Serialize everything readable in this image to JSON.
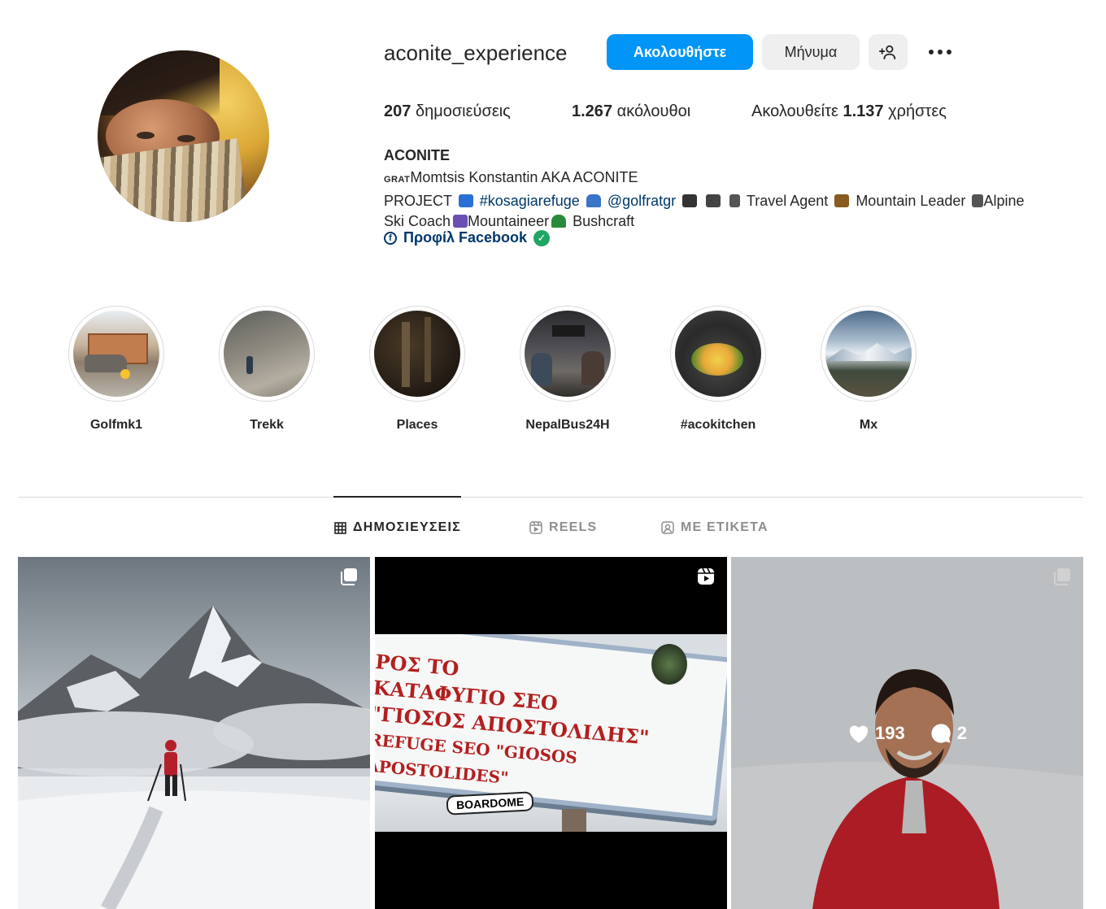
{
  "profile": {
    "username": "aconite_experience",
    "follow_label": "Ακολουθήστε",
    "message_label": "Μήνυμα",
    "add_user_icon": "add-user-icon",
    "more_icon": "more-icon",
    "stats": {
      "posts_count": "207",
      "posts_label": "δημοσιεύσεις",
      "followers_count": "1.267",
      "followers_label": "ακόλουθοι",
      "following_prefix": "Ακολουθείτε",
      "following_count": "1.137",
      "following_suffix": "χρήστες"
    },
    "bio": {
      "name": "ACONITE",
      "line1_small": "GRAT",
      "line1": "Momtsis Konstantin AKA ACONITE",
      "project": "PROJECT",
      "hashtag": "#kosagiarefuge",
      "mention": "@golfratgr",
      "travel": "Travel Agent",
      "mountain": "Mountain Leader",
      "alpine": "Alpine",
      "ski": "Ski Coach",
      "mountaineer": "Mountaineer",
      "bushcraft": "Bushcraft"
    },
    "facebook_label": "Προφίλ Facebook"
  },
  "highlights": [
    {
      "label": "Golfmk1"
    },
    {
      "label": "Trekk"
    },
    {
      "label": "Places"
    },
    {
      "label": "NepalBus24H"
    },
    {
      "label": "#acokitchen"
    },
    {
      "label": "Mx"
    }
  ],
  "tabs": [
    {
      "label": "ΔΗΜΟΣΙΕΥΣΕΙΣ",
      "icon": "grid-icon",
      "active": true
    },
    {
      "label": "REELS",
      "icon": "reels-icon",
      "active": false
    },
    {
      "label": "ΜΕ ΕΤΙΚΕΤΑ",
      "icon": "tagged-icon",
      "active": false
    }
  ],
  "posts": [
    {
      "type": "carousel",
      "icon": "carousel-icon"
    },
    {
      "type": "reel",
      "icon": "reel-icon",
      "sign_lines": [
        "ΡΟΣ ΤΟ",
        "ΚΑΤΑΦΥΓΙΟ ΣΕΟ",
        "\"ΓΙΟΣΟΣ ΑΠΟΣΤΟΛΙΔΗΣ\"",
        "REFUGE SEO  \"GIOSOS APOSTOLIDES\""
      ],
      "brand": "BOARDOME"
    },
    {
      "type": "carousel",
      "icon": "carousel-icon",
      "likes": "193",
      "comments": "2"
    }
  ],
  "colors": {
    "accent": "#0095f6",
    "link": "#00376b",
    "verified": "#20a563"
  }
}
